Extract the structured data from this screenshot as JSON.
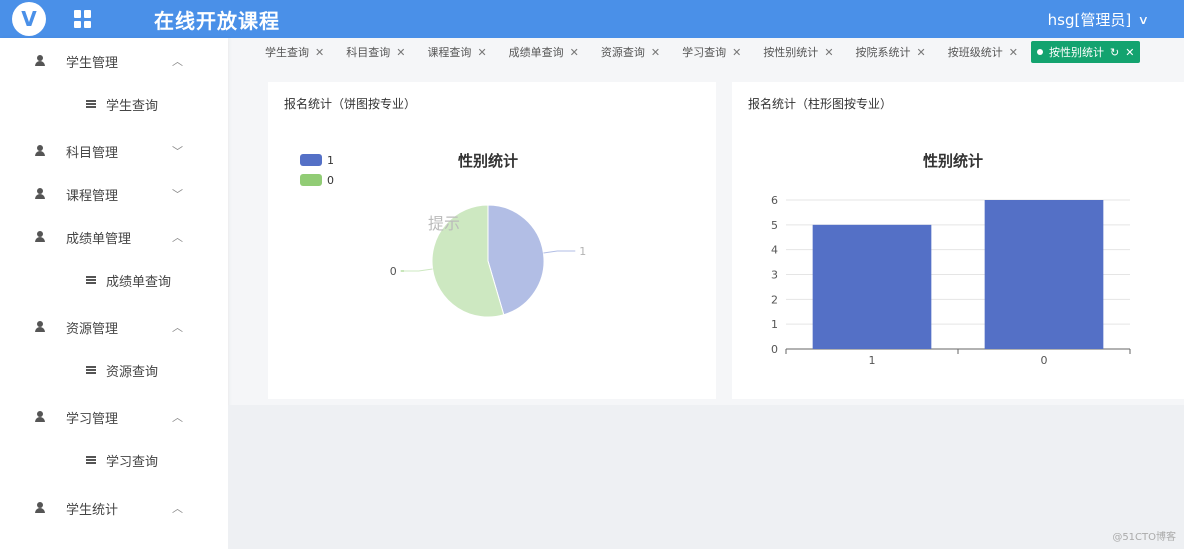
{
  "header": {
    "app_title": "在线开放课程",
    "user": "hsg[管理员]",
    "logo_icon": "logo-v-icon",
    "menu_icon": "grid-icon"
  },
  "sidebar": {
    "items": [
      {
        "label": "学生管理",
        "expanded": true,
        "children": [
          "学生查询"
        ]
      },
      {
        "label": "科目管理",
        "expanded": false,
        "children": []
      },
      {
        "label": "课程管理",
        "expanded": false,
        "children": []
      },
      {
        "label": "成绩单管理",
        "expanded": true,
        "children": [
          "成绩单查询"
        ]
      },
      {
        "label": "资源管理",
        "expanded": true,
        "children": [
          "资源查询"
        ]
      },
      {
        "label": "学习管理",
        "expanded": true,
        "children": [
          "学习查询"
        ]
      },
      {
        "label": "学生统计",
        "expanded": true,
        "children": []
      }
    ]
  },
  "tabs": [
    "学生查询",
    "科目查询",
    "课程查询",
    "成绩单查询",
    "资源查询",
    "学习查询",
    "按性别统计",
    "按院系统计",
    "按班级统计",
    "按性别统计"
  ],
  "active_tab_index": 9,
  "pie_card": {
    "title": "报名统计（饼图按专业）"
  },
  "bar_card": {
    "title": "报名统计（柱形图按专业）"
  },
  "dialog": {
    "title": "提示"
  },
  "watermark": "@51CTO博客",
  "colors": {
    "blue": "#5470c6",
    "green": "#91cc75",
    "accent": "#13a36f",
    "header": "#4a90e8"
  },
  "chart_data": [
    {
      "type": "pie",
      "title": "性别统计",
      "labels": [
        "1",
        "0"
      ],
      "values": [
        5,
        6
      ],
      "legend": "top-left"
    },
    {
      "type": "bar",
      "title": "性别统计",
      "categories": [
        "1",
        "0"
      ],
      "values": [
        5,
        6
      ],
      "ylim": [
        0,
        6
      ],
      "yticks": [
        "0",
        "1",
        "2",
        "3",
        "4",
        "5",
        "6"
      ],
      "grid": true
    }
  ]
}
